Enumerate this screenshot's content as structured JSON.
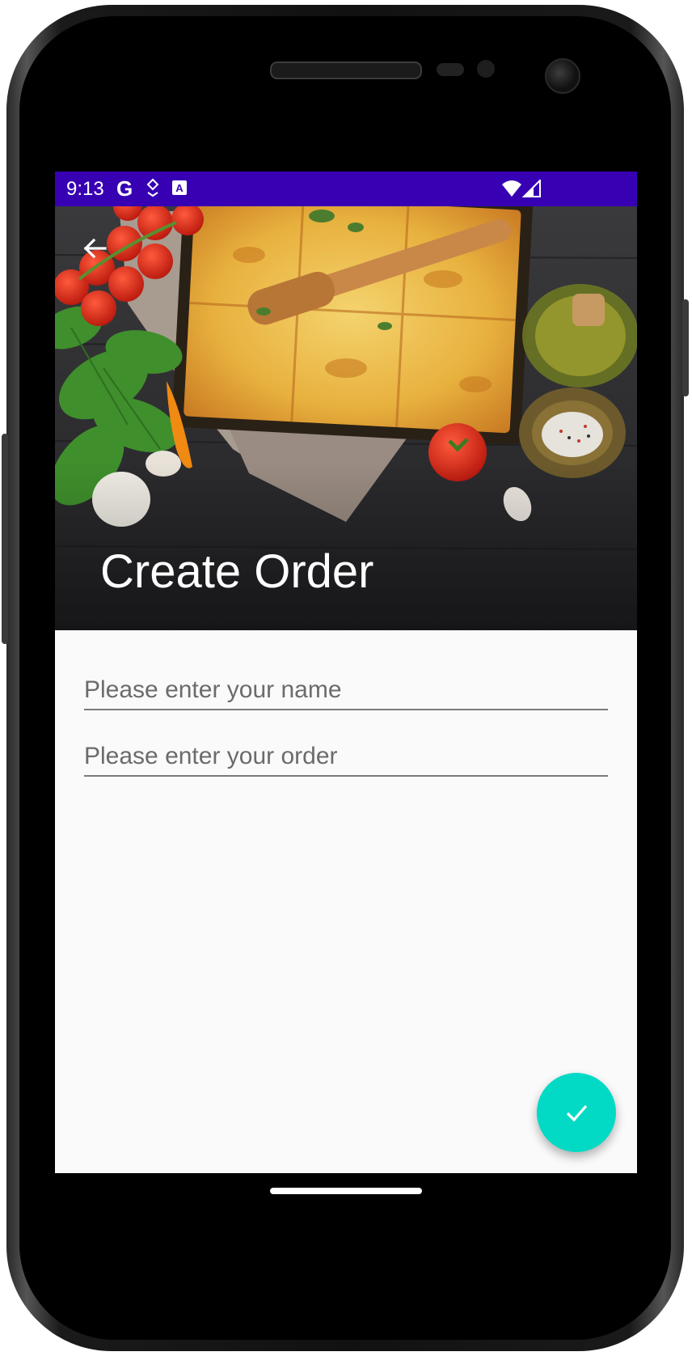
{
  "status_bar": {
    "time": "9:13",
    "icons": [
      "google-icon",
      "location-pin-icon",
      "accessibility-a-icon",
      "wifi-icon",
      "signal-icon"
    ],
    "background_color": "#3700b3"
  },
  "header": {
    "title": "Create Order",
    "back_icon": "arrow-back-icon"
  },
  "form": {
    "name_field": {
      "value": "",
      "placeholder": "Please enter your name"
    },
    "order_field": {
      "value": "",
      "placeholder": "Please enter your order"
    }
  },
  "fab": {
    "icon": "check-icon",
    "color": "#03dac5"
  }
}
